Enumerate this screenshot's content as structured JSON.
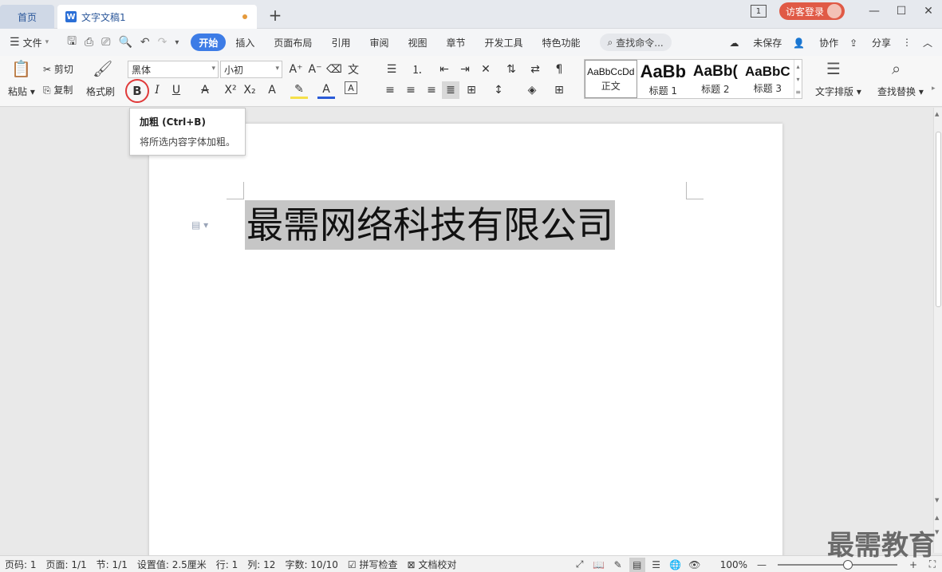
{
  "titlebar": {
    "home_tab": "首页",
    "doc_tab": "文字文稿1",
    "doc_icon": "W",
    "badge_num": "1",
    "login": "访客登录"
  },
  "menubar": {
    "file": "文件",
    "tabs": [
      "开始",
      "插入",
      "页面布局",
      "引用",
      "审阅",
      "视图",
      "章节",
      "开发工具",
      "特色功能"
    ],
    "search": "查找命令...",
    "unsaved": "未保存",
    "collab": "协作",
    "share": "分享"
  },
  "ribbon": {
    "paste": "粘贴",
    "cut": "剪切",
    "copy": "复制",
    "format_painter": "格式刷",
    "font_name": "黑体",
    "font_size": "小初",
    "bold": "B",
    "italic": "I",
    "underline": "U",
    "styles": [
      {
        "preview": "AaBbCcDd",
        "name": "正文"
      },
      {
        "preview": "AaBb",
        "name": "标题 1"
      },
      {
        "preview": "AaBb(",
        "name": "标题 2"
      },
      {
        "preview": "AaBbC",
        "name": "标题 3"
      }
    ],
    "text_layout": "文字排版",
    "find_replace": "查找替换"
  },
  "tooltip": {
    "title": "加粗 (Ctrl+B)",
    "desc": "将所选内容字体加粗。"
  },
  "document": {
    "text": "最需网络科技有限公司"
  },
  "statusbar": {
    "page_no": "页码: 1",
    "page": "页面: 1/1",
    "section": "节: 1/1",
    "setting": "设置值: 2.5厘米",
    "row": "行: 1",
    "col": "列: 12",
    "word_count": "字数: 10/10",
    "spell_check": "拼写检查",
    "doc_proof": "文档校对",
    "zoom": "100%"
  },
  "watermark": "最需教育",
  "colors": {
    "accent": "#3d7ce6",
    "highlight_circle": "#e03a3a",
    "login_bg": "#e05a46",
    "selection": "#c6c6c6"
  }
}
